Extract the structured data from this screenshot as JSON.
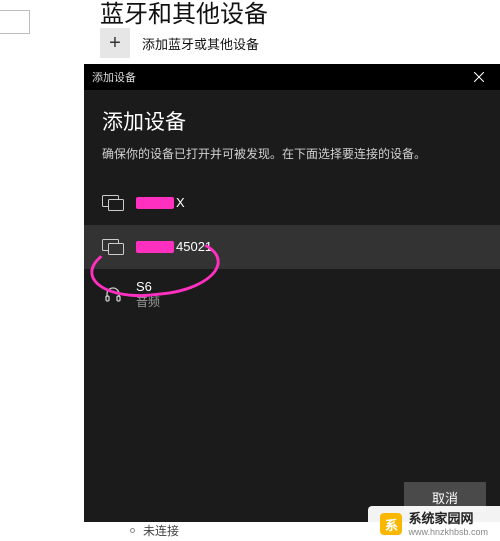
{
  "background": {
    "heading_fragment": "蓝牙和其他设备",
    "add_label": "添加蓝牙或其他设备",
    "status_text": "未连接"
  },
  "modal": {
    "window_title": "添加设备",
    "heading": "添加设备",
    "subtitle": "确保你的设备已打开并可被发现。在下面选择要连接的设备。",
    "cancel_label": "取消",
    "devices": {
      "d0": {
        "name_suffix": "X",
        "redacted": true
      },
      "d1": {
        "name_suffix": "45021",
        "redacted": true
      },
      "d2": {
        "name": "S6",
        "sub": "音频"
      }
    }
  },
  "watermark": {
    "name": "系统家园网",
    "url": "www.hnzkhbsb.com"
  }
}
